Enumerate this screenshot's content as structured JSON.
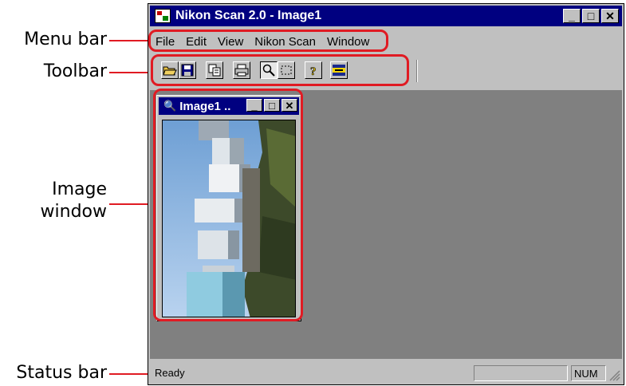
{
  "callouts": {
    "menu_bar": "Menu bar",
    "toolbar": "Toolbar",
    "image_window_line1": "Image",
    "image_window_line2": "window",
    "status_bar": "Status bar"
  },
  "window": {
    "title": "Nikon Scan 2.0 - Image1",
    "minimize": "_",
    "maximize": "□",
    "close": "✕"
  },
  "menu": [
    "File",
    "Edit",
    "View",
    "Nikon Scan",
    "Window"
  ],
  "toolbar": {
    "buttons": [
      "open-icon",
      "save-icon",
      "copy-icon",
      "print-icon",
      "zoom-icon",
      "marquee-icon",
      "help-icon",
      "nikon-icon"
    ]
  },
  "image_window": {
    "title": "Image1 ..",
    "minimize": "_",
    "maximize": "□",
    "close": "✕"
  },
  "statusbar": {
    "text": "Ready",
    "num": "NUM"
  },
  "colors": {
    "highlight": "#e01b23",
    "titlebar": "#000080",
    "client": "#808080"
  }
}
